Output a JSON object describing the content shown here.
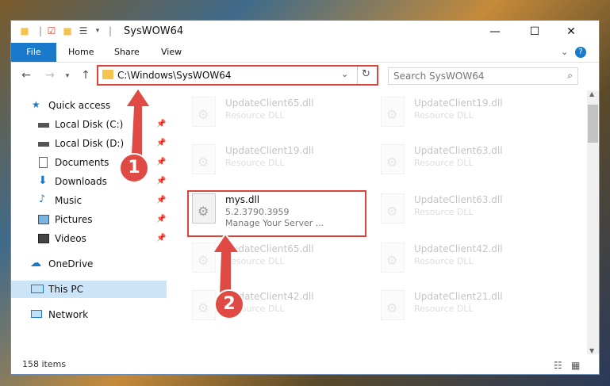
{
  "window": {
    "title": "SysWOW64",
    "controls": {
      "minimize": "—",
      "maximize": "☐",
      "close": "✕"
    }
  },
  "ribbon": {
    "tabs": [
      "File",
      "Home",
      "Share",
      "View"
    ],
    "help": "?",
    "collapse": "⌄"
  },
  "address": {
    "path": "C:\\Windows\\SysWOW64",
    "search_placeholder": "Search SysWOW64"
  },
  "nav": {
    "items": [
      {
        "label": "Quick access",
        "pinned": false
      },
      {
        "label": "Local Disk (C:)",
        "pinned": true
      },
      {
        "label": "Local Disk (D:)",
        "pinned": true
      },
      {
        "label": "Documents",
        "pinned": true
      },
      {
        "label": "Downloads",
        "pinned": true
      },
      {
        "label": "Music",
        "pinned": true
      },
      {
        "label": "Pictures",
        "pinned": true
      },
      {
        "label": "Videos",
        "pinned": true
      },
      {
        "label": "OneDrive",
        "pinned": false
      },
      {
        "label": "This PC",
        "pinned": false
      },
      {
        "label": "Network",
        "pinned": false
      }
    ],
    "selected": "This PC"
  },
  "files": {
    "left": [
      {
        "name": "UpdateClient65.dll",
        "desc": "Resource DLL"
      },
      {
        "name": "UpdateClient19.dll",
        "desc": "Resource DLL"
      },
      {
        "name": "mys.dll",
        "version": "5.2.3790.3959",
        "desc": "Manage Your Server ..."
      },
      {
        "name": "UpdateClient65.dll",
        "desc": "Resource DLL"
      },
      {
        "name": "UpdateClient42.dll",
        "desc": "Resource DLL"
      }
    ],
    "right": [
      {
        "name": "UpdateClient19.dll",
        "desc": "Resource DLL"
      },
      {
        "name": "UpdateClient63.dll",
        "desc": "Resource DLL"
      },
      {
        "name": "UpdateClient63.dll",
        "desc": "Resource DLL"
      },
      {
        "name": "UpdateClient42.dll",
        "desc": "Resource DLL"
      },
      {
        "name": "UpdateClient21.dll",
        "desc": "Resource DLL"
      }
    ]
  },
  "status": {
    "count": "158 items"
  },
  "annotations": {
    "step1": "1",
    "step2": "2"
  },
  "colors": {
    "accent": "#1979ca",
    "annotation": "#d9453d",
    "selected": "#cce4f7"
  }
}
